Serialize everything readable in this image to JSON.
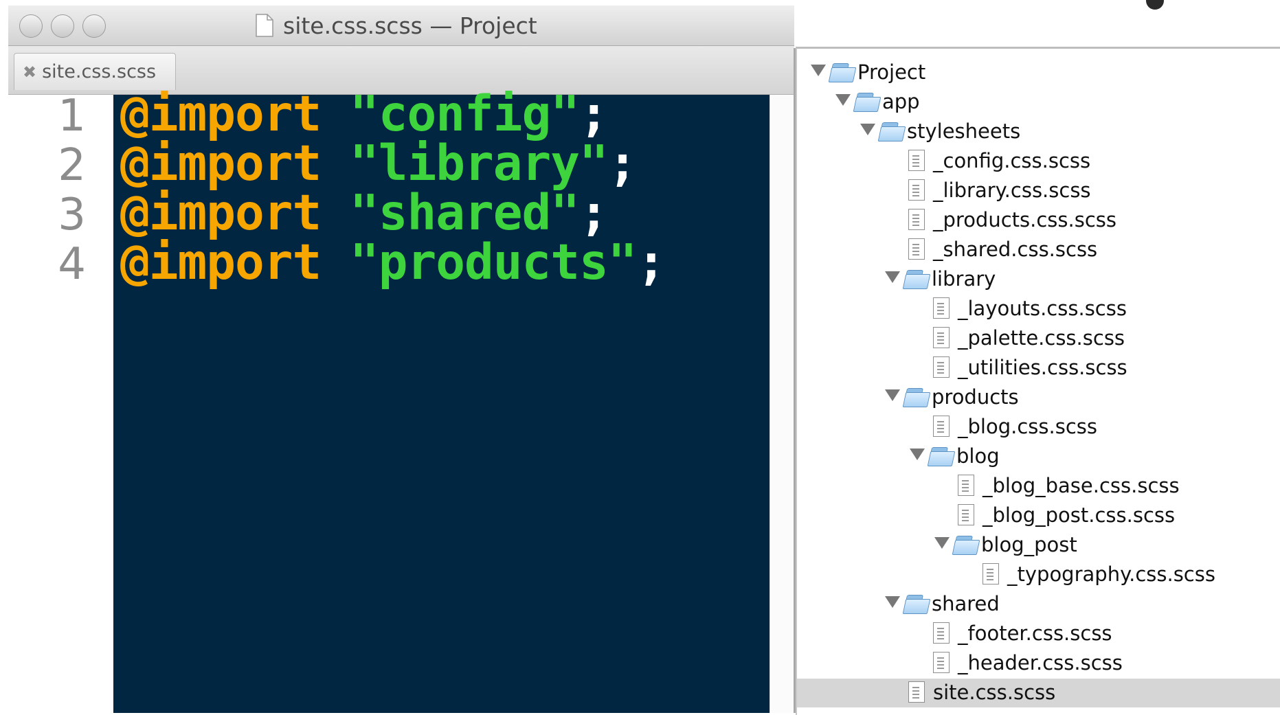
{
  "window": {
    "title": "site.css.scss — Project",
    "tab_label": "site.css.scss",
    "tab_close": "✖"
  },
  "editor": {
    "line_numbers": [
      "1",
      "2",
      "3",
      "4"
    ],
    "lines": [
      {
        "keyword": "@import",
        "string": "\"config\"",
        "punct": ";"
      },
      {
        "keyword": "@import",
        "string": "\"library\"",
        "punct": ";"
      },
      {
        "keyword": "@import",
        "string": "\"shared\"",
        "punct": ";"
      },
      {
        "keyword": "@import",
        "string": "\"products\"",
        "punct": ";"
      }
    ],
    "colors": {
      "background": "#012641",
      "keyword": "#f7a600",
      "string": "#3ed43e",
      "punctuation": "#ffffff"
    }
  },
  "project_tree": {
    "items": [
      {
        "label": "Project",
        "type": "folder"
      },
      {
        "label": "app",
        "type": "folder"
      },
      {
        "label": "stylesheets",
        "type": "folder"
      },
      {
        "label": "_config.css.scss",
        "type": "file"
      },
      {
        "label": "_library.css.scss",
        "type": "file"
      },
      {
        "label": "_products.css.scss",
        "type": "file"
      },
      {
        "label": "_shared.css.scss",
        "type": "file"
      },
      {
        "label": "library",
        "type": "folder"
      },
      {
        "label": "_layouts.css.scss",
        "type": "file"
      },
      {
        "label": "_palette.css.scss",
        "type": "file"
      },
      {
        "label": "_utilities.css.scss",
        "type": "file"
      },
      {
        "label": "products",
        "type": "folder"
      },
      {
        "label": "_blog.css.scss",
        "type": "file"
      },
      {
        "label": "blog",
        "type": "folder"
      },
      {
        "label": "_blog_base.css.scss",
        "type": "file"
      },
      {
        "label": "_blog_post.css.scss",
        "type": "file"
      },
      {
        "label": "blog_post",
        "type": "folder"
      },
      {
        "label": "_typography.css.scss",
        "type": "file"
      },
      {
        "label": "shared",
        "type": "folder"
      },
      {
        "label": "_footer.css.scss",
        "type": "file"
      },
      {
        "label": "_header.css.scss",
        "type": "file"
      },
      {
        "label": "site.css.scss",
        "type": "file",
        "selected": true
      }
    ]
  }
}
